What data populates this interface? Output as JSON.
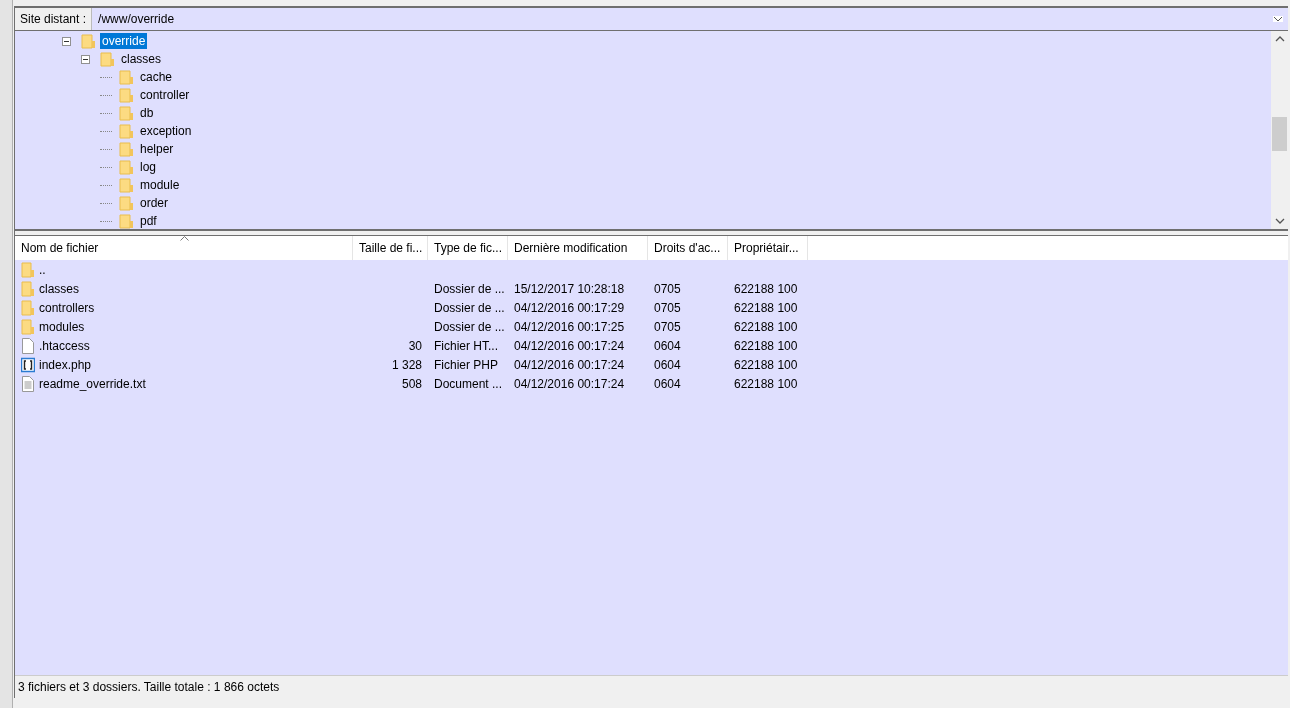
{
  "path_bar": {
    "label": "Site distant :",
    "value": "/www/override"
  },
  "tree": [
    {
      "label": "override",
      "selected": true,
      "expanded": true,
      "children": [
        {
          "label": "classes",
          "selected": false,
          "expanded": true,
          "children": [
            {
              "label": "cache",
              "selected": false
            },
            {
              "label": "controller",
              "selected": false
            },
            {
              "label": "db",
              "selected": false
            },
            {
              "label": "exception",
              "selected": false
            },
            {
              "label": "helper",
              "selected": false
            },
            {
              "label": "log",
              "selected": false
            },
            {
              "label": "module",
              "selected": false
            },
            {
              "label": "order",
              "selected": false
            },
            {
              "label": "pdf",
              "selected": false
            }
          ]
        }
      ]
    }
  ],
  "table": {
    "columns": [
      {
        "label": "Nom de fichier",
        "sorted": true
      },
      {
        "label": "Taille de fi...",
        "sorted": false
      },
      {
        "label": "Type de fic...",
        "sorted": false
      },
      {
        "label": "Dernière modification",
        "sorted": false
      },
      {
        "label": "Droits d'ac...",
        "sorted": false
      },
      {
        "label": "Propriétair...",
        "sorted": false
      }
    ],
    "rows": [
      {
        "kind": "folder",
        "name": "..",
        "size": "",
        "type": "",
        "modified": "",
        "rights": "",
        "owner": ""
      },
      {
        "kind": "folder",
        "name": "classes",
        "size": "",
        "type": "Dossier de ...",
        "modified": "15/12/2017 10:28:18",
        "rights": "0705",
        "owner": "622188 100"
      },
      {
        "kind": "folder",
        "name": "controllers",
        "size": "",
        "type": "Dossier de ...",
        "modified": "04/12/2016 00:17:29",
        "rights": "0705",
        "owner": "622188 100"
      },
      {
        "kind": "folder",
        "name": "modules",
        "size": "",
        "type": "Dossier de ...",
        "modified": "04/12/2016 00:17:25",
        "rights": "0705",
        "owner": "622188 100"
      },
      {
        "kind": "file",
        "name": ".htaccess",
        "size": "30",
        "type": "Fichier HT...",
        "modified": "04/12/2016 00:17:24",
        "rights": "0604",
        "owner": "622188 100"
      },
      {
        "kind": "code",
        "name": "index.php",
        "size": "1 328",
        "type": "Fichier PHP",
        "modified": "04/12/2016 00:17:24",
        "rights": "0604",
        "owner": "622188 100"
      },
      {
        "kind": "text",
        "name": "readme_override.txt",
        "size": "508",
        "type": "Document ...",
        "modified": "04/12/2016 00:17:24",
        "rights": "0604",
        "owner": "622188 100"
      }
    ]
  },
  "status_bar": "3 fichiers et 3 dossiers. Taille totale : 1 866 octets"
}
